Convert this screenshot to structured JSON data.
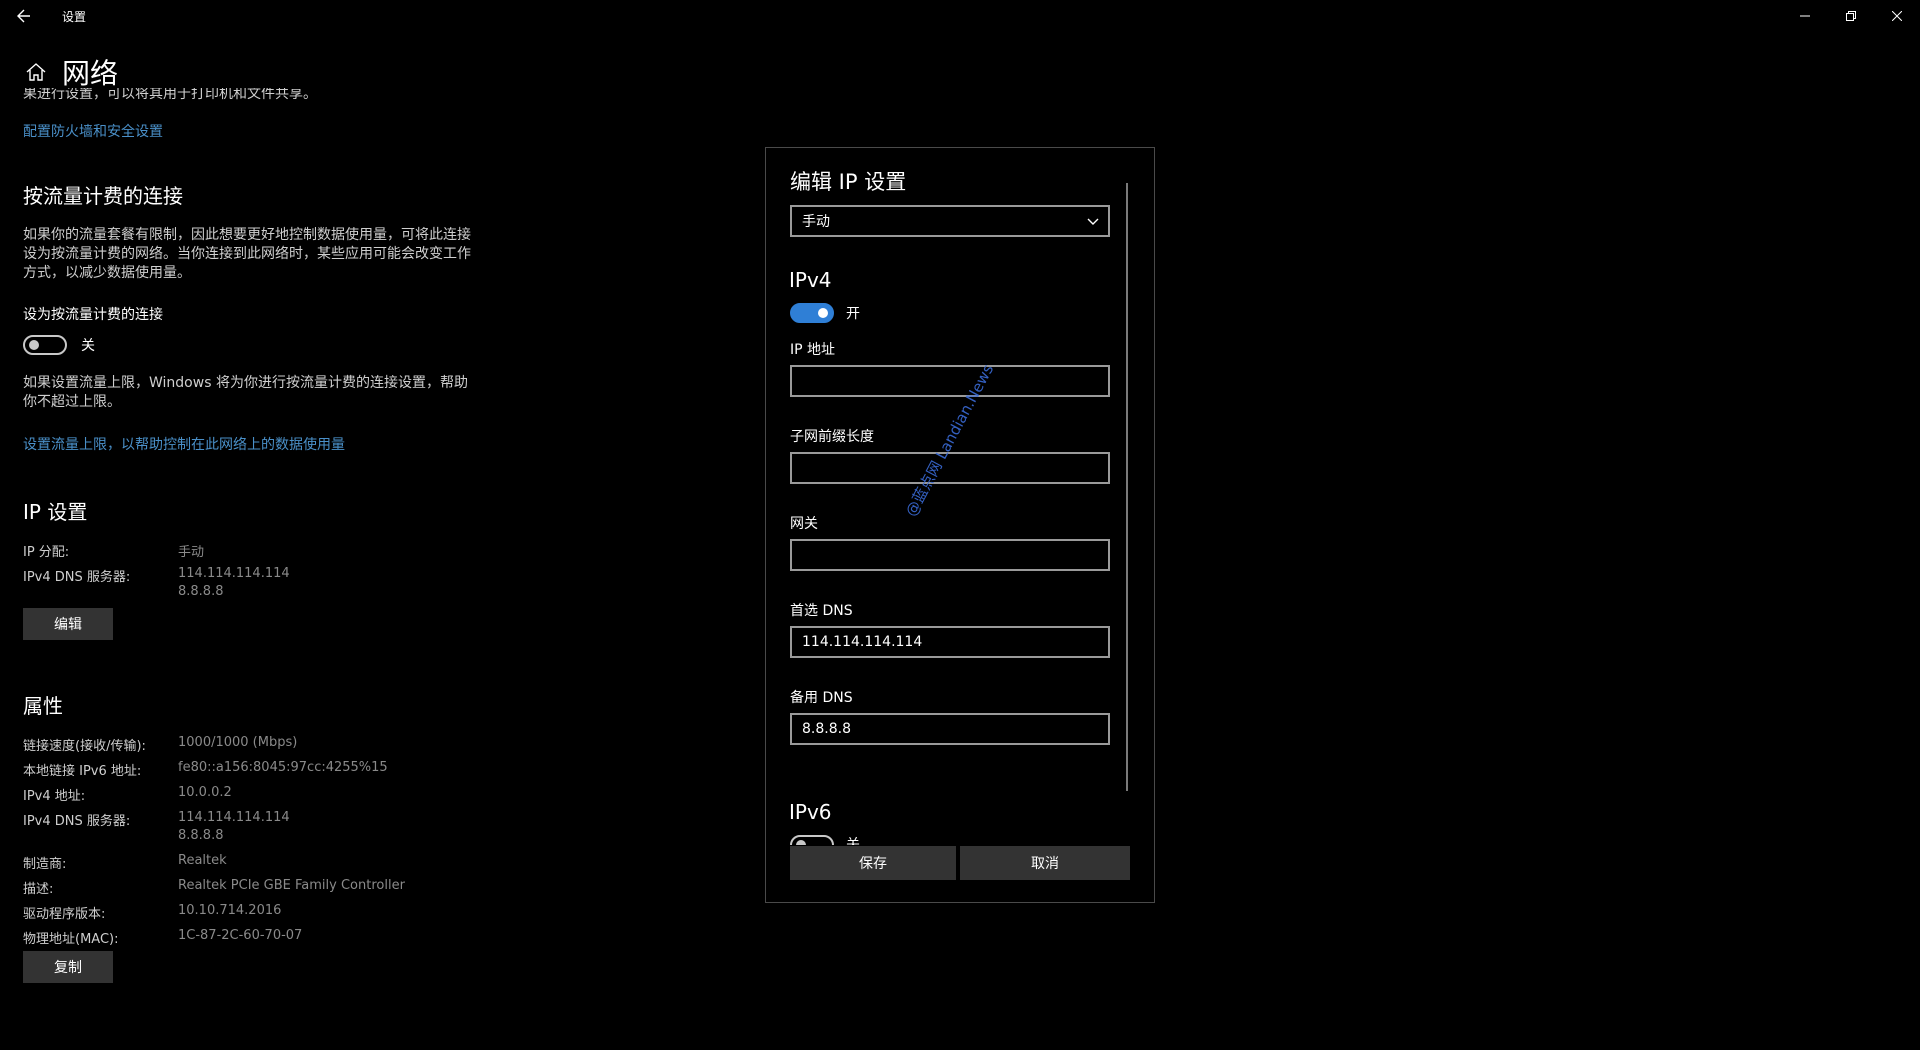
{
  "window": {
    "title": "设置",
    "back_icon": "back-arrow-icon",
    "minimize_glyph": "—",
    "maximize_glyph": "❐",
    "close_glyph": "✕"
  },
  "header": {
    "title": "网络",
    "icon": "home-icon"
  },
  "left": {
    "cut_text": "果进行设置，可以将其用于打印机和文件共享。",
    "firewall_link": "配置防火墙和安全设置",
    "metered": {
      "title": "按流量计费的连接",
      "description": "如果你的流量套餐有限制，因此想要更好地控制数据使用量，可将此连接设为按流量计费的网络。当你连接到此网络时，某些应用可能会改变工作方式，以减少数据使用量。",
      "toggle_label": "设为按流量计费的连接",
      "toggle_state": "关",
      "limit_text": "如果设置流量上限，Windows 将为你进行按流量计费的连接设置，帮助你不超过上限。",
      "limit_link": "设置流量上限，以帮助控制在此网络上的数据使用量"
    },
    "ip_settings": {
      "title": "IP 设置",
      "assign_label": "IP 分配:",
      "assign_value": "手动",
      "dns_label": "IPv4 DNS 服务器:",
      "dns_value_1": "114.114.114.114",
      "dns_value_2": "8.8.8.8",
      "edit_button": "编辑"
    },
    "properties": {
      "title": "属性",
      "rows": [
        {
          "k": "链接速度(接收/传输):",
          "v": "1000/1000 (Mbps)"
        },
        {
          "k": "本地链接 IPv6 地址:",
          "v": "fe80::a156:8045:97cc:4255%15"
        },
        {
          "k": "IPv4 地址:",
          "v": "10.0.0.2"
        },
        {
          "k": "IPv4 DNS 服务器:",
          "v": "114.114.114.114",
          "v2": "8.8.8.8"
        },
        {
          "k": "制造商:",
          "v": "Realtek"
        },
        {
          "k": "描述:",
          "v": "Realtek PCIe GBE Family Controller"
        },
        {
          "k": "驱动程序版本:",
          "v": "10.10.714.2016"
        },
        {
          "k": "物理地址(MAC):",
          "v": "1C-87-2C-60-70-07"
        }
      ],
      "copy_button": "复制"
    }
  },
  "dialog": {
    "title": "编辑 IP 设置",
    "mode_selected": "手动",
    "ipv4": {
      "title": "IPv4",
      "toggle_state": "开",
      "ip_label": "IP 地址",
      "ip_value": "",
      "prefix_label": "子网前缀长度",
      "prefix_value": "",
      "gateway_label": "网关",
      "gateway_value": "",
      "dns1_label": "首选 DNS",
      "dns1_value": "114.114.114.114",
      "dns2_label": "备用 DNS",
      "dns2_value": "8.8.8.8"
    },
    "ipv6": {
      "title": "IPv6",
      "toggle_state": "关"
    },
    "save_button": "保存",
    "cancel_button": "取消"
  },
  "watermark": "@蓝点网 Landian.News",
  "colors": {
    "accent": "#2f7fd6",
    "link": "#4a90c9",
    "background": "#000000"
  }
}
